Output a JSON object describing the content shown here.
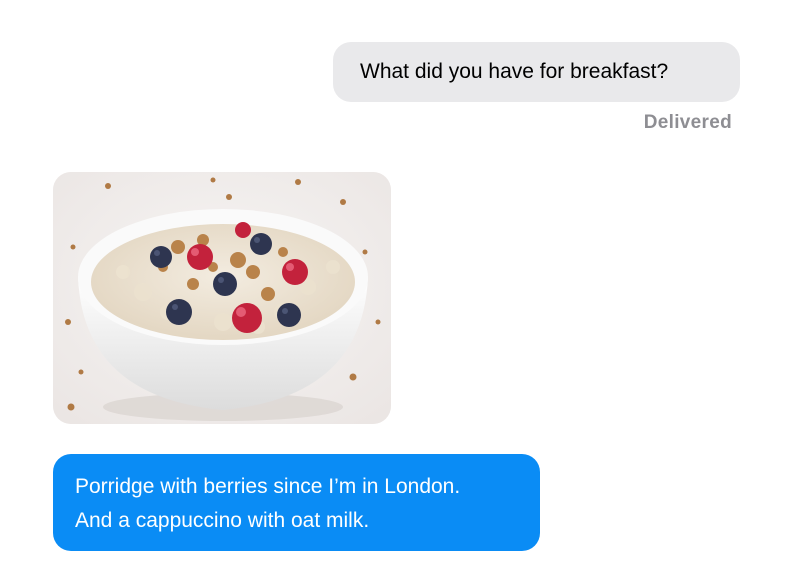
{
  "messages": {
    "outgoing": {
      "text": "What did you have for breakfast?",
      "status": "Delivered"
    },
    "incoming_photo": {
      "icon": "porridge-bowl-photo"
    },
    "incoming": {
      "line1": "Porridge with berries since I’m in London.",
      "line2": "And a cappuccino with oat milk."
    }
  },
  "colors": {
    "outgoing_bubble": "#e9e9eb",
    "incoming_bubble": "#0a8cf5",
    "status_text": "#8e8e93"
  }
}
